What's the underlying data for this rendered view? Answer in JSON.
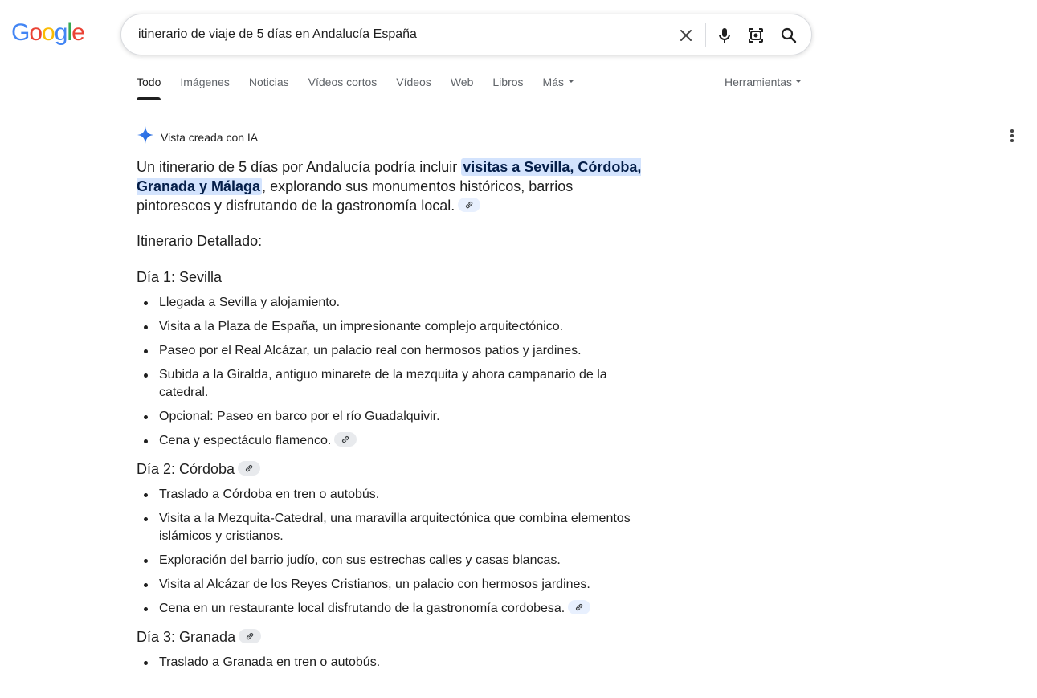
{
  "logo": {
    "letters": [
      "G",
      "o",
      "o",
      "g",
      "l",
      "e"
    ],
    "colors": [
      "#4285F4",
      "#EA4335",
      "#FBBC05",
      "#4285F4",
      "#34A853",
      "#EA4335"
    ]
  },
  "search": {
    "query": "itinerario de viaje de 5 días en Andalucía España"
  },
  "tabs": [
    {
      "label": "Todo"
    },
    {
      "label": "Imágenes"
    },
    {
      "label": "Noticias"
    },
    {
      "label": "Vídeos cortos"
    },
    {
      "label": "Vídeos"
    },
    {
      "label": "Web"
    },
    {
      "label": "Libros"
    },
    {
      "label": "Más"
    }
  ],
  "tools_label": "Herramientas",
  "ai": {
    "header_label": "Vista creada con IA",
    "intro_pre": "Un itinerario de 5 días por Andalucía podría incluir ",
    "intro_highlight": "visitas a Sevilla, Córdoba, Granada y Málaga",
    "intro_post": ", explorando sus monumentos históricos, barrios pintorescos y disfrutando de la gastronomía local.",
    "detailed_title": "Itinerario Detallado:",
    "days": [
      {
        "title": "Día 1: Sevilla",
        "items": [
          "Llegada a Sevilla y alojamiento.",
          "Visita a la Plaza de España, un impresionante complejo arquitectónico.",
          "Paseo por el Real Alcázar, un palacio real con hermosos patios y jardines.",
          "Subida a la Giralda, antiguo minarete de la mezquita y ahora campanario de la catedral.",
          "Opcional: Paseo en barco por el río Guadalquivir.",
          "Cena y espectáculo flamenco."
        ]
      },
      {
        "title": "Día 2: Córdoba",
        "items": [
          "Traslado a Córdoba en tren o autobús.",
          "Visita a la Mezquita-Catedral, una maravilla arquitectónica que combina elementos islámicos y cristianos.",
          "Exploración del barrio judío, con sus estrechas calles y casas blancas.",
          "Visita al Alcázar de los Reyes Cristianos, un palacio con hermosos jardines.",
          "Cena en un restaurante local disfrutando de la gastronomía cordobesa."
        ]
      },
      {
        "title": "Día 3: Granada",
        "items": [
          "Traslado a Granada en tren o autobús."
        ]
      }
    ]
  },
  "colors": {
    "accent": "#1a73e8",
    "highlight_bg": "#d3e3fd",
    "text": "#1f1f1f",
    "muted": "#5f6368"
  }
}
